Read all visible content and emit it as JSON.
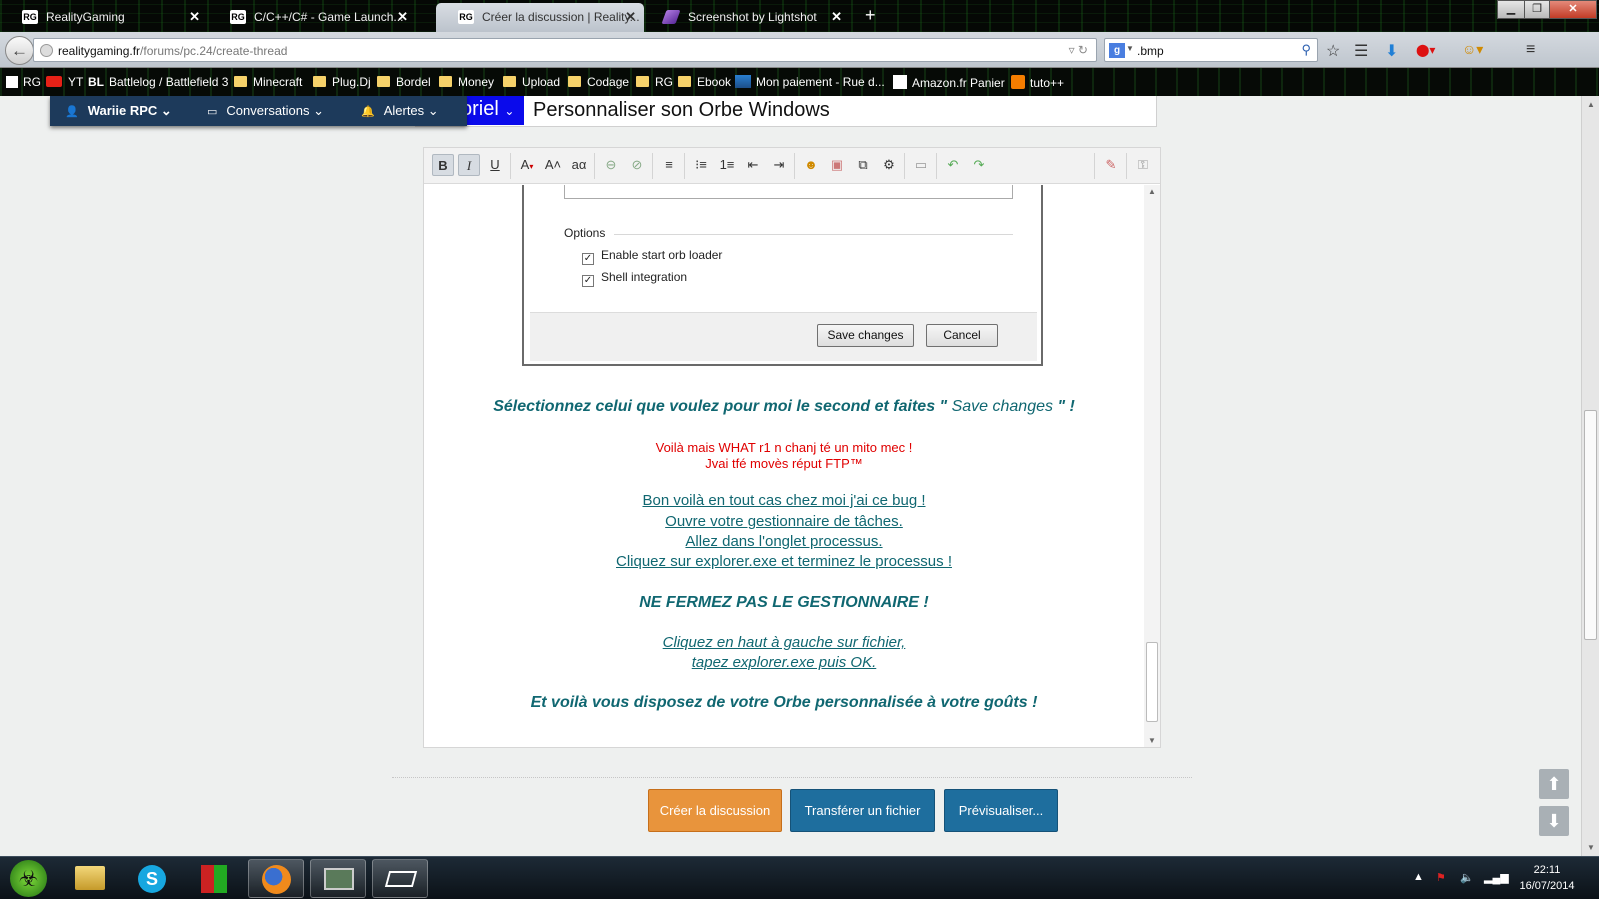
{
  "tabs": [
    {
      "title": "RealityGaming",
      "close": "✕"
    },
    {
      "title": "C/C++/C# - Game Launch...",
      "close": "✕"
    },
    {
      "title": "Créer la discussion | Reality...",
      "close": "✕"
    },
    {
      "title": "Screenshot by Lightshot",
      "close": "✕"
    }
  ],
  "address": {
    "host": "realitygaming.fr",
    "path": "/forums/pc.24/create-thread"
  },
  "search": {
    "value": ".bmp",
    "engine": "g"
  },
  "bookmarks": [
    "RG",
    "YT",
    "Battlelog / Battlefield 3",
    "Minecraft",
    "Plug.Dj",
    "Bordel",
    "Money",
    "Upload",
    "Codage",
    "RG",
    "Ebook",
    "Mon paiement - Rue d...",
    "Amazon.fr Panier",
    "tuto++"
  ],
  "userbar": {
    "user": "Wariie RPC",
    "conversations": "Conversations",
    "alerts": "Alertes"
  },
  "thread": {
    "prefix": "oriel",
    "title": "Personnaliser son Orbe Windows"
  },
  "editor": {
    "embedded": {
      "options_header": "Options",
      "checkbox1": "Enable start orb loader",
      "checkbox2": "Shell integration",
      "save_button": "Save changes",
      "cancel_button": "Cancel"
    },
    "line1_a": "Sélectionnez celui que voulez pour moi le second et faites \"",
    "line1_b": "Save changes",
    "line1_c": "\" !",
    "red1": "Voilà mais WHAT r1 n chanj té un mito mec !",
    "red2": "Jvai tfé  movès réput FTP™",
    "steps": [
      "Bon voilà en tout cas chez moi j'ai ce bug !",
      "Ouvre votre gestionnaire de tâches.",
      "Allez dans l'onglet processus.",
      "Cliquez sur explorer.exe et terminez le processus !"
    ],
    "warning": "NE FERMEZ PAS LE GESTIONNAIRE !",
    "final_steps": [
      "Cliquez en haut à gauche sur fichier,",
      "tapez explorer.exe puis OK."
    ],
    "closing": "Et voilà vous disposez de votre Orbe personnalisée à votre goûts !"
  },
  "actions": {
    "create": "Créer la discussion",
    "upload": "Transférer un fichier",
    "preview": "Prévisualiser..."
  },
  "clock": {
    "time": "22:11",
    "date": "16/07/2014"
  },
  "colors": {
    "teal_text": "#106771",
    "create_button": "#e8943c",
    "blue_button": "#1e6e9e",
    "userbar": "#1d3a5b",
    "prefix": "#0a0aeb"
  }
}
